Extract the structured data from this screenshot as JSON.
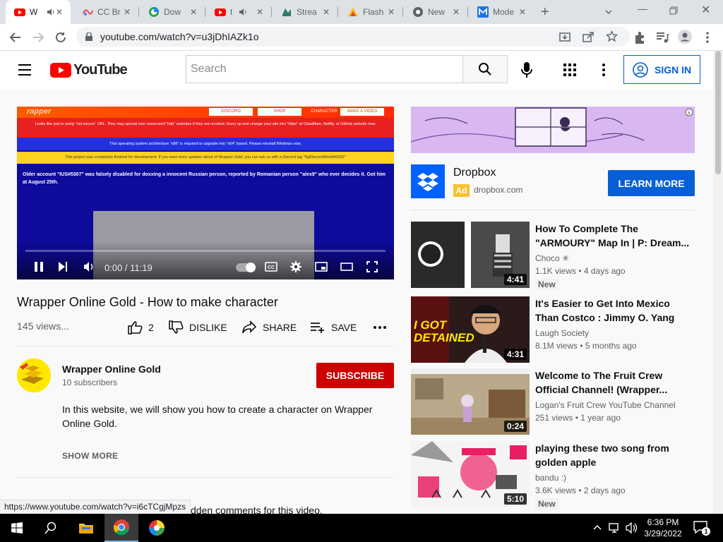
{
  "browser": {
    "tabs": [
      {
        "title": "W",
        "icon": "youtube-icon",
        "active": true
      },
      {
        "title": "CC Br",
        "icon": "cc-icon",
        "active": false
      },
      {
        "title": "Dow",
        "icon": "download-site-icon",
        "active": false
      },
      {
        "title": "t",
        "icon": "youtube-icon",
        "active": false
      },
      {
        "title": "Strea",
        "icon": "stream-icon",
        "active": false
      },
      {
        "title": "Flash",
        "icon": "flash-icon",
        "active": false
      },
      {
        "title": "New",
        "icon": "chrome-icon",
        "active": false
      },
      {
        "title": "Mode",
        "icon": "m-icon",
        "active": false
      }
    ],
    "url": "youtube.com/watch?v=u3jDhIAZk1o",
    "status_url": "https://www.youtube.com/watch?v=i6cTCgjMpzs"
  },
  "youtube": {
    "logo_text": "YouTube",
    "search_placeholder": "Search",
    "signin_label": "SIGN IN"
  },
  "video": {
    "title": "Wrapper Online Gold - How to make character",
    "views": "145 views...",
    "likes": "2",
    "dislike_label": "DISLIKE",
    "share_label": "SHARE",
    "save_label": "SAVE",
    "time": "0:00 / 11:19",
    "progress_fraction": 0.0,
    "screen": {
      "brand": "rapper",
      "nav": [
        "DISCORD",
        "SHOP",
        "CHARACTER",
        "MAKE A VIDEO"
      ],
      "warning1": "Looks like you're using \"not secure\" URL. They may spread over unsecured \"http\" websites if they not revoked. Hurry up and change your site into \"https\" at Cloudflare, Netlify, or GitHub website now.",
      "warning2": "This operating system architecture \"x86\" is required to upgrade into \"x64\" based. Please reinstall Windows now.",
      "warning3": "This project was completely finished for development. If you want more updates about of Wrapper Gold, you can ask us with a Discord tag \"5gtDiscordWorld#0202\"",
      "notice": "Older account \"IUS#5307\" was falsely disabled for doxxing a innocent Russian person, reported by Romanian person \"alex9\" who ever decides it. Got him at August 25th."
    }
  },
  "channel": {
    "name": "Wrapper Online Gold",
    "subscribers": "10 subscribers",
    "subscribe_label": "SUBSCRIBE",
    "description": "In this website, we will show you how to create a character on Wrapper Online Gold.",
    "show_more": "SHOW MORE",
    "comments_note": "dden comments for this video."
  },
  "ad": {
    "name": "Dropbox",
    "tag": "Ad",
    "domain": "dropbox.com",
    "cta": "LEARN MORE"
  },
  "recommendations": [
    {
      "title": "How To Complete The \"ARMOURY\" Map In | P: Dream...",
      "channel": "Choco ✳",
      "meta": "1.1K views • 4 days ago",
      "duration": "4:41",
      "badge": "New"
    },
    {
      "title": "It's Easier to Get Into Mexico Than Costco : Jimmy O. Yang",
      "channel": "Laugh Society",
      "meta": "8.1M views • 5 months ago",
      "duration": "4:31",
      "badge": "",
      "thumb_text": "I GOT DETAINED"
    },
    {
      "title": "Welcome to The Fruit Crew Official Channel! (Wrapper...",
      "channel": "Logan's Fruit Crew YouTube Channel",
      "meta": "251 views • 1 year ago",
      "duration": "0:24",
      "badge": ""
    },
    {
      "title": "playing these two song from golden apple",
      "channel": "bandu :)",
      "meta": "3.6K views • 2 days ago",
      "duration": "5:10",
      "badge": "New"
    }
  ],
  "taskbar": {
    "time": "6:36 PM",
    "date": "3/29/2022",
    "notification_count": "1"
  }
}
